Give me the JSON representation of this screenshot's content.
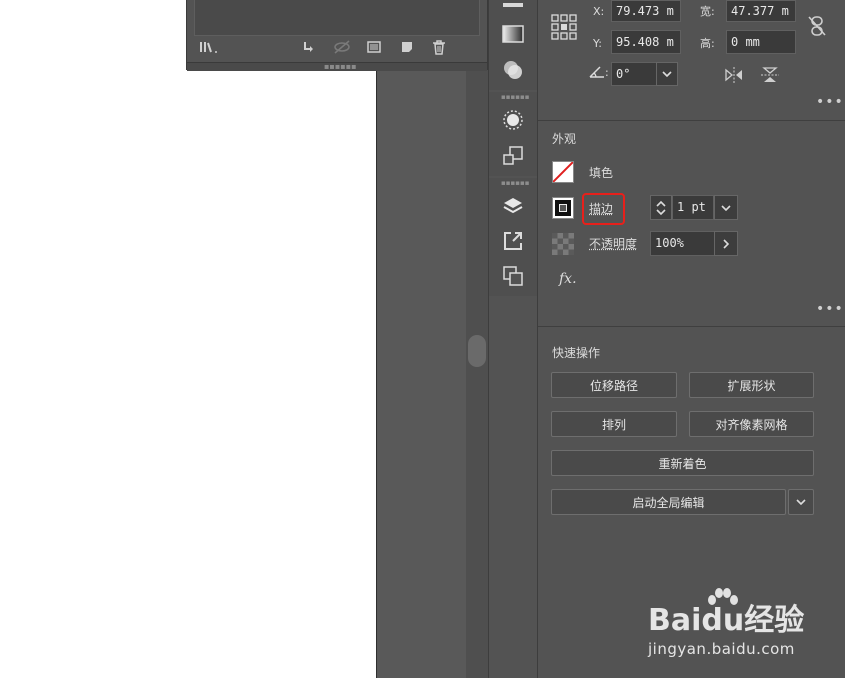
{
  "layers_panel": {
    "bottom_icons": [
      "library-icon",
      "export-arrow-icon",
      "unlink-icon",
      "collect-icon",
      "new-layer-icon",
      "trash-icon"
    ]
  },
  "properties": {
    "transform": {
      "x_label": "X:",
      "x_value": "79.473 m",
      "y_label": "Y:",
      "y_value": "95.408 m",
      "w_label": "宽:",
      "w_value": "47.377 m",
      "h_label": "高:",
      "h_value": "0 mm",
      "angle_value": "0°"
    },
    "appearance": {
      "title": "外观",
      "fill_label": "填色",
      "stroke_label": "描边",
      "stroke_weight": "1 pt",
      "opacity_label": "不透明度",
      "opacity_value": "100%",
      "fx_label": "fx."
    },
    "quick_actions": {
      "title": "快速操作",
      "offset_path": "位移路径",
      "expand_shape": "扩展形状",
      "arrange": "排列",
      "align_pixel_grid": "对齐像素网格",
      "recolor": "重新着色",
      "global_edit": "启动全局编辑"
    },
    "more_label": "•••"
  },
  "watermark": {
    "brand": "Baidu经验",
    "url": "jingyan.baidu.com"
  },
  "colors": {
    "panel_bg": "#535353",
    "highlight_red": "#e8201b",
    "fill_none_red": "#e02020"
  }
}
